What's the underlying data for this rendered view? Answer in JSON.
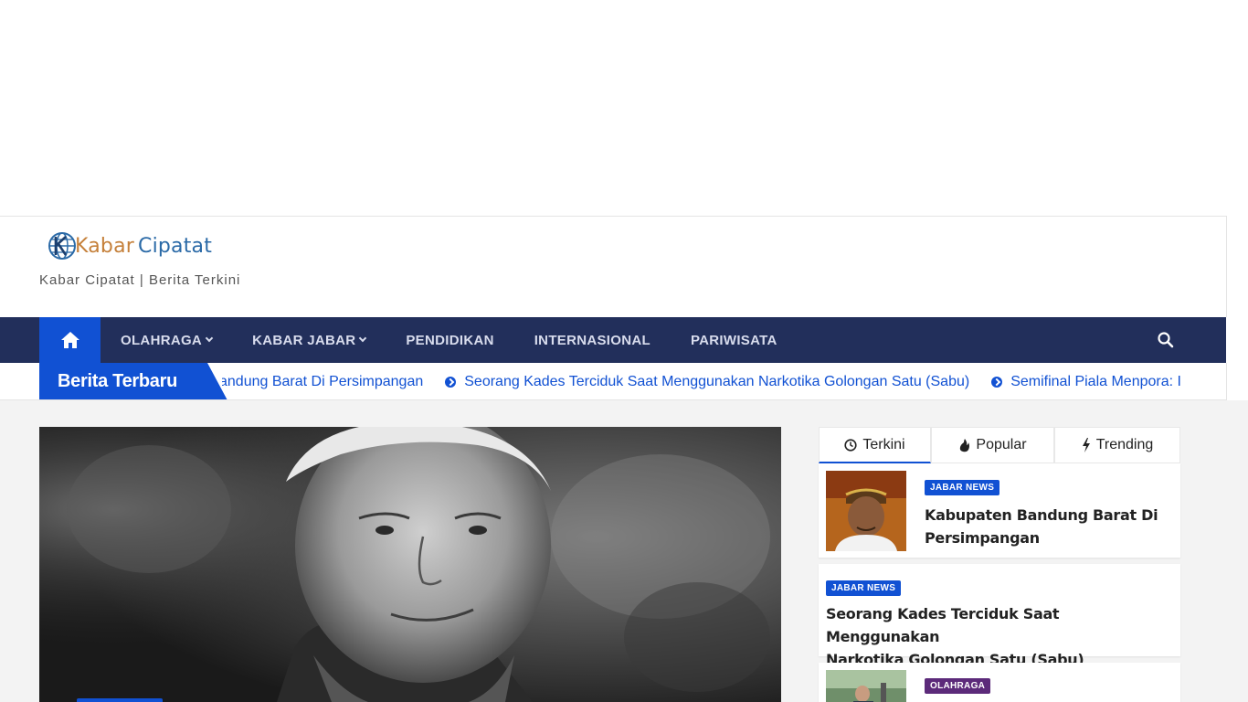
{
  "site": {
    "logo_word1": "Kabar",
    "logo_word2": "Cipatat",
    "tagline": "Kabar Cipatat | Berita Terkini"
  },
  "nav": {
    "home_icon": "home-icon",
    "items": [
      {
        "label": "OLAHRAGA",
        "dropdown": true
      },
      {
        "label": "KABAR JABAR",
        "dropdown": true
      },
      {
        "label": "PENDIDIKAN",
        "dropdown": false
      },
      {
        "label": "INTERNASIONAL",
        "dropdown": false
      },
      {
        "label": "PARIWISATA",
        "dropdown": false
      }
    ],
    "search_icon": "search-icon"
  },
  "ticker": {
    "label": "Berita Terbaru",
    "items": [
      "andung Barat Di Persimpangan",
      "Seorang Kades Terciduk Saat Menggunakan Narkotika Golongan Satu (Sabu)",
      "Semifinal Piala Menpora: I"
    ]
  },
  "sidebar": {
    "tabs": [
      {
        "label": "Terkini",
        "icon": "clock-icon",
        "active": true
      },
      {
        "label": "Popular",
        "icon": "fire-icon",
        "active": false
      },
      {
        "label": "Trending",
        "icon": "bolt-icon",
        "active": false
      }
    ],
    "posts": [
      {
        "category": "JABAR NEWS",
        "title_line1": "Kabupaten Bandung Barat Di",
        "title_line2": "Persimpangan"
      },
      {
        "category": "JABAR NEWS",
        "title_line1": "Seorang Kades Terciduk Saat Menggunakan",
        "title_line2": "Narkotika Golongan Satu (Sabu)"
      },
      {
        "category": "OLAHRAGA",
        "title_line1": "",
        "title_line2": ""
      }
    ]
  },
  "colors": {
    "accent": "#1151d3",
    "navbar": "#222f5b",
    "olahraga_badge": "#5c2a7a"
  }
}
